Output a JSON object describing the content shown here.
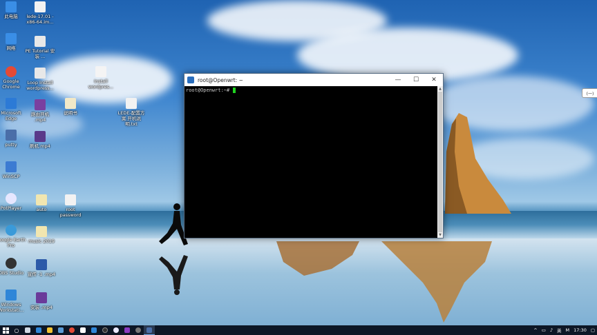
{
  "desktop": {
    "icons": [
      {
        "label": "此电脑",
        "color": "#3a8ee6"
      },
      {
        "label": "lede-17.01 -x86-64.im...",
        "color": "#f2f2f2"
      },
      {
        "label": "网络",
        "color": "#3a8ee6"
      },
      {
        "label": "PE Tutorial 安装 ...",
        "color": "#e8e8e8"
      },
      {
        "label": "Google Chrome",
        "color": "#e44a36"
      },
      {
        "label": "Loop Install wordpress...",
        "color": "#e8e8e8"
      },
      {
        "label": "Install wordpres...",
        "color": "#f4f4f4"
      },
      {
        "label": "Microsoft Edge",
        "color": "#2c7ad6"
      },
      {
        "label": "路由开机 .mp4",
        "color": "#7a3fa0"
      },
      {
        "label": "说明书",
        "color": "#f2e9c8"
      },
      {
        "label": "LEDE-配置方案 开机说明.txt",
        "color": "#f2f2f2"
      },
      {
        "label": "putty",
        "color": "#4a6ea8"
      },
      {
        "label": "刷机.mp4",
        "color": "#5a3a8a"
      },
      {
        "label": "WinSCP",
        "color": "#3c7bd2"
      },
      {
        "label": "PotPlayer",
        "color": "#e7e7ff"
      },
      {
        "label": "auto",
        "color": "#f1e6b0"
      },
      {
        "label": "root password",
        "color": "#f2f2f2"
      },
      {
        "label": "Google Earth Pro",
        "color": "#3a9ad9"
      },
      {
        "label": "music 2019",
        "color": "#f1e6b0"
      },
      {
        "label": "OBS Studio",
        "color": "#333333"
      },
      {
        "label": "宣传 -1 .mp4",
        "color": "#2c5aa8"
      },
      {
        "label": "Windows Workstati...",
        "color": "#2f86d8"
      },
      {
        "label": "安装 .mp4",
        "color": "#6a3a9a"
      }
    ]
  },
  "terminal": {
    "title": "root@Openwrt: ~",
    "prompt": "root@Openwrt:~# ",
    "controls": {
      "minimize": "—",
      "maximize": "☐",
      "close": "✕"
    },
    "scroll_up": "▲",
    "scroll_down": "▼"
  },
  "side_popup": {
    "label": "(一)"
  },
  "taskbar": {
    "start_icon": "windows-logo-icon",
    "search_symbol": "○",
    "apps": [
      {
        "name": "taskview",
        "color": "#cfd8e3"
      },
      {
        "name": "edge",
        "color": "#2f86d8"
      },
      {
        "name": "explorer",
        "color": "#f1c232"
      },
      {
        "name": "store",
        "color": "#5a9bd6"
      },
      {
        "name": "chrome",
        "color": "#e44a36"
      },
      {
        "name": "mail",
        "color": "#ffffff"
      },
      {
        "name": "edge2",
        "color": "#2f86d8"
      },
      {
        "name": "obs",
        "color": "#333333"
      },
      {
        "name": "potplayer",
        "color": "#e9e9ff"
      },
      {
        "name": "media",
        "color": "#8a3ac0"
      },
      {
        "name": "settings",
        "color": "#777777"
      },
      {
        "name": "putty",
        "color": "#4a6ea8"
      }
    ],
    "active_app": 11,
    "tray": {
      "up_arrow": "^",
      "ime": "英",
      "ime2": "M",
      "time": "17:30"
    }
  }
}
